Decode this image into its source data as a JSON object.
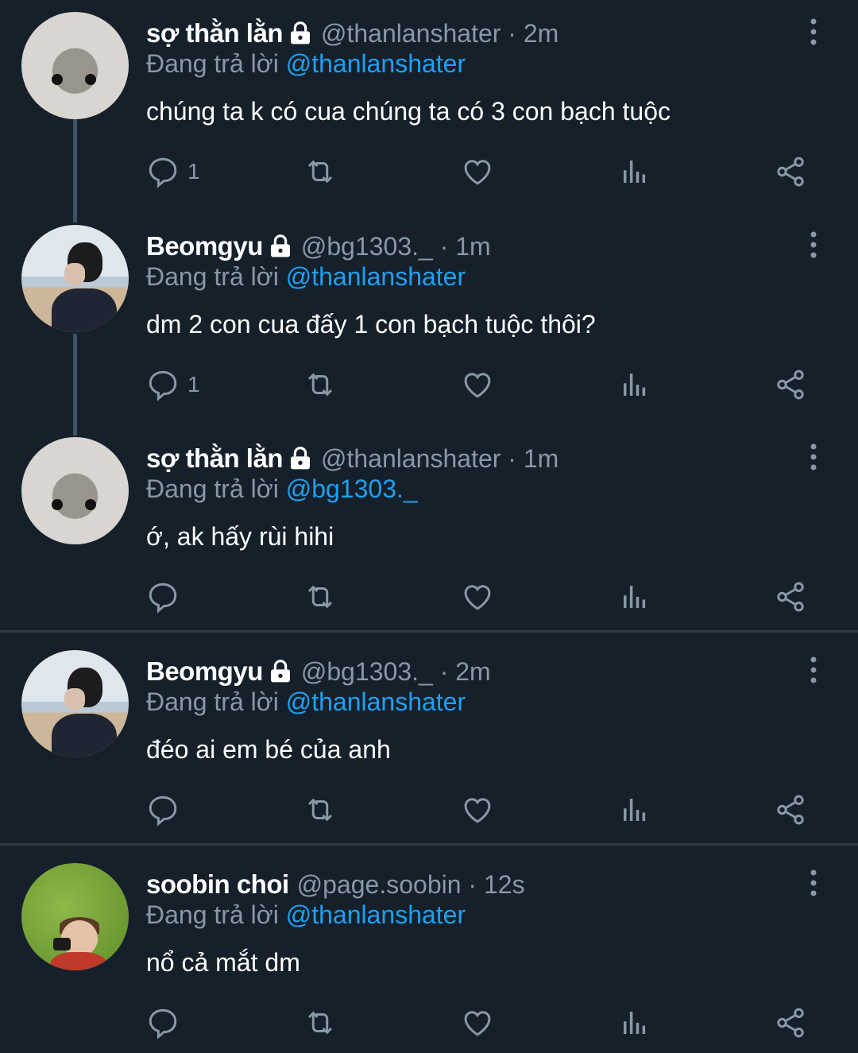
{
  "colors": {
    "background": "#15202b",
    "secondary": "#8899a6",
    "mention": "#1da1f2",
    "divider": "#2f3b47"
  },
  "reply_prefix": "Đang trả lời",
  "tweets": [
    {
      "name": "sợ thằn lằn",
      "handle": "@thanlanshater · 2m",
      "mention": "@thanlanshater",
      "text": "chúng ta k có cua chúng ta có 3 con bạch tuộc",
      "reply_count": "1",
      "locked": true,
      "avatar": "hamster"
    },
    {
      "name": "Beomgyu",
      "handle": "@bg1303._ · 1m",
      "mention": "@thanlanshater",
      "text": "dm 2 con cua đấy 1 con bạch tuộc thôi?",
      "reply_count": "1",
      "locked": true,
      "avatar": "beach-boy"
    },
    {
      "name": "sợ thằn lằn",
      "handle": "@thanlanshater · 1m",
      "mention": "@bg1303._",
      "text": "ớ, ak hấy rùi hihi",
      "reply_count": "",
      "locked": true,
      "avatar": "hamster"
    },
    {
      "name": "Beomgyu",
      "handle": "@bg1303._ · 2m",
      "mention": "@thanlanshater",
      "text": "đéo ai em bé của anh",
      "reply_count": "",
      "locked": true,
      "avatar": "beach-boy"
    },
    {
      "name": "soobin choi",
      "handle": "@page.soobin · 12s",
      "mention": "@thanlanshater",
      "text": "nổ cả mắt dm",
      "reply_count": "",
      "locked": false,
      "avatar": "grass-boy"
    }
  ],
  "icons": [
    "reply-icon",
    "retweet-icon",
    "like-icon",
    "analytics-icon",
    "share-icon",
    "more-icon",
    "lock-icon"
  ]
}
